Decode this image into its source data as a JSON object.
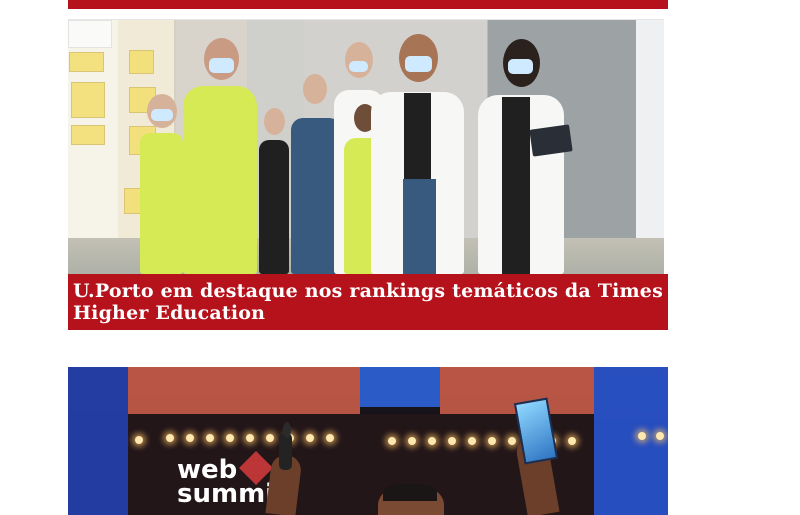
{
  "articles": [
    {
      "image": {
        "alt": "Estudantes de medicina com máscaras num corredor",
        "scene": "students-in-medical-scrubs-and-white-coats-corridor"
      },
      "headline": "U.Porto em destaque nos rankings temáticos da Times Higher Education"
    },
    {
      "image": {
        "alt": "Palco da Web Summit",
        "scene": "speaker-holding-trophy-on-web-summit-stage",
        "logo_text_1": "web",
        "logo_text_2": "summi"
      }
    }
  ],
  "colors": {
    "accent": "#b5121b",
    "headline_text": "#ffffff"
  }
}
